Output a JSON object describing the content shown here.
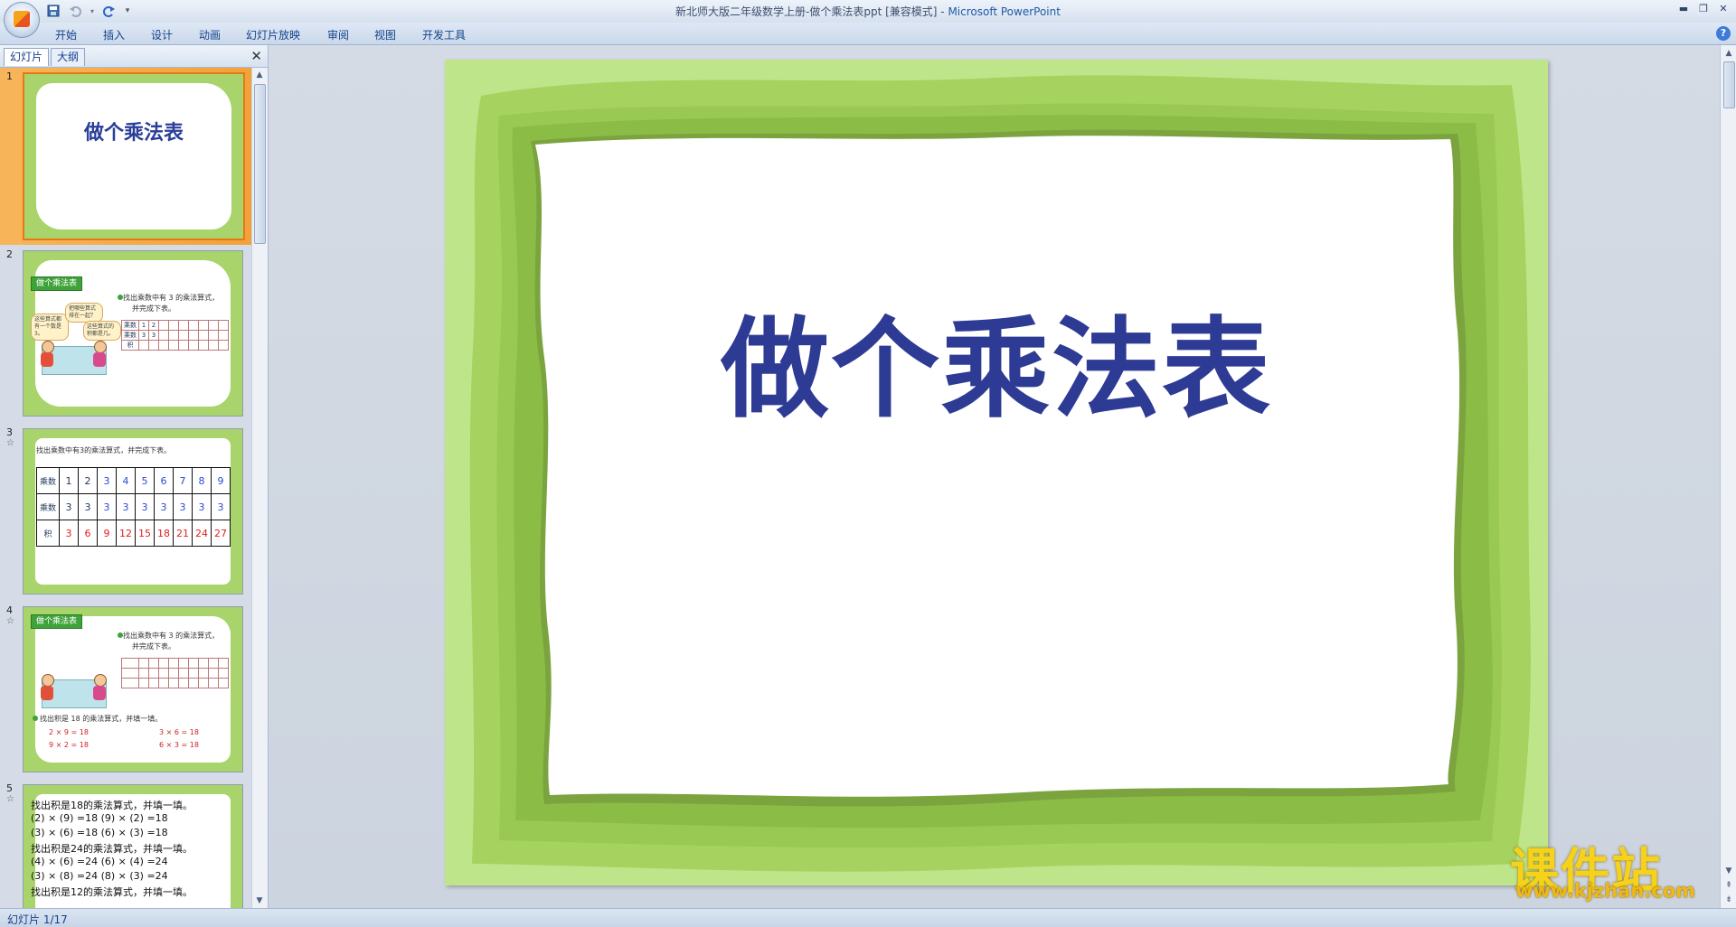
{
  "window": {
    "title_doc": "新北师大版二年级数学上册-做个乘法表ppt [兼容模式] - ",
    "title_app": "Microsoft PowerPoint"
  },
  "ribbon": {
    "tabs": [
      "开始",
      "插入",
      "设计",
      "动画",
      "幻灯片放映",
      "审阅",
      "视图",
      "开发工具"
    ]
  },
  "panel": {
    "tab_slides": "幻灯片",
    "tab_outline": "大纲",
    "close": "✕"
  },
  "thumbnails": [
    {
      "num": "1",
      "title": "做个乘法表"
    },
    {
      "num": "2",
      "tag": "做个乘法表",
      "line1": "找出乘数中有 3 的乘法算式，",
      "line2": "并完成下表。",
      "bubble1": "这些算式都有一个数是3。",
      "bubble2": "把哪些算式排在一起？",
      "bubble3": "这些算式的积都是几。",
      "row_a": "乘数",
      "row_b": "乘数",
      "row_c": "积",
      "v1": "1",
      "v2": "2",
      "v3": "3",
      "v4": "3"
    },
    {
      "num": "3",
      "star": "☆",
      "heading": "找出乘数中有3的乘法算式，并完成下表。",
      "row_a_label": "乘数",
      "row_a": [
        "1",
        "2",
        "3",
        "4",
        "5",
        "6",
        "7",
        "8",
        "9"
      ],
      "row_b_label": "乘数",
      "row_b": [
        "3",
        "3",
        "3",
        "3",
        "3",
        "3",
        "3",
        "3",
        "3"
      ],
      "row_c_label": "积",
      "row_c": [
        "3",
        "6",
        "9",
        "12",
        "15",
        "18",
        "21",
        "24",
        "27"
      ]
    },
    {
      "num": "4",
      "star": "☆",
      "tag": "做个乘法表",
      "line1": "找出乘数中有 3 的乘法算式，",
      "line2": "并完成下表。",
      "line3": "找出积是 18 的乘法算式，并填一填。",
      "eq1": "2 × 9 = 18",
      "eq2": "9 × 2 = 18",
      "eq3": "3 × 6 = 18",
      "eq4": "6 × 3 = 18"
    },
    {
      "num": "5",
      "star": "☆",
      "lines": [
        "找出积是18的乘法算式，并填一填。",
        "(2) × (9) =18  (9) × (2) =18",
        "(3) × (6) =18  (6) × (3) =18",
        "找出积是24的乘法算式，并填一填。",
        "(4) × (6) =24  (6) × (4) =24",
        "(3) × (8) =24  (8) × (3) =24",
        "找出积是12的乘法算式，并填一填。"
      ]
    }
  ],
  "slide": {
    "title": "做个乘法表"
  },
  "status": {
    "text": "幻灯片 1/17"
  },
  "watermark": {
    "cn": "课件站",
    "url": "www.kjzhan.com"
  },
  "colors": {
    "slide_frame": "#a6d25f",
    "slide_frame_light": "#c3e88b",
    "title_color": "#2e3b94",
    "selected_thumb": "#f3a13a"
  }
}
